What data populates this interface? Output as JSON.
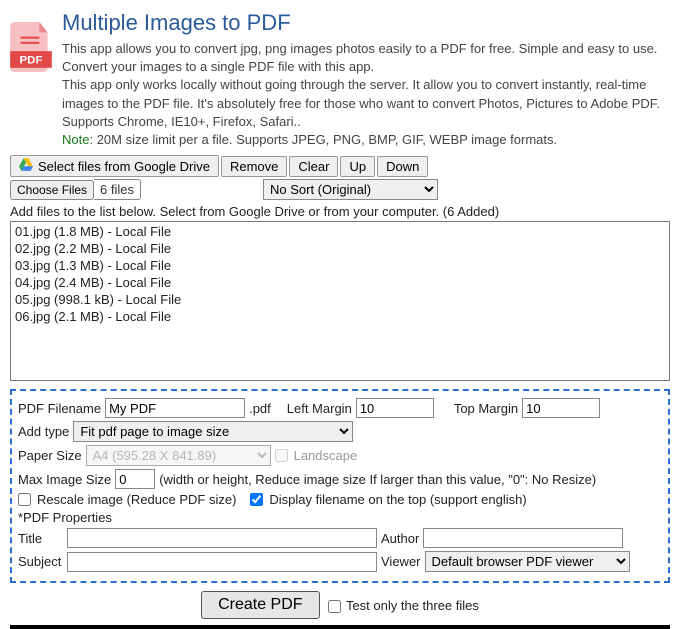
{
  "header": {
    "title": "Multiple Images to PDF",
    "desc1": "This app allows you to convert jpg, png images photos easily to a PDF for free. Simple and easy to use. Convert your images to a single PDF file with this app.",
    "desc2": "This app only works locally without going through the server. It allow you to convert instantly, real-time images to the PDF file. It's absolutely free for those who want to convert Photos, Pictures to Adobe PDF. Supports Chrome, IE10+, Firefox, Safari..",
    "note_label": "Note:",
    "note_text": " 20M size limit per a file. Supports JPEG, PNG, BMP, GIF, WEBP image formats."
  },
  "toolbar": {
    "gdrive": "Select files from Google Drive",
    "remove": "Remove",
    "clear": "Clear",
    "up": "Up",
    "down": "Down",
    "choose": "Choose Files",
    "file_count": "6 files",
    "sort_selected": "No Sort (Original)"
  },
  "instruction": "Add files to the list below. Select from Google Drive or from your computer. (6 Added)",
  "files": [
    "01.jpg (1.8 MB) - Local File",
    "02.jpg (2.2 MB) - Local File",
    "03.jpg (1.3 MB) - Local File",
    "04.jpg (2.4 MB) - Local File",
    "05.jpg (998.1 kB) - Local File",
    "06.jpg (2.1 MB) - Local File"
  ],
  "options": {
    "filename_label": "PDF Filename",
    "filename_value": "My PDF",
    "filename_ext": ".pdf",
    "left_margin_label": "Left Margin",
    "left_margin_value": "10",
    "top_margin_label": "Top Margin",
    "top_margin_value": "10",
    "addtype_label": "Add type",
    "addtype_value": "Fit pdf page to image size",
    "papersize_label": "Paper Size",
    "papersize_value": "A4 (595.28 X 841.89)",
    "landscape_label": "Landscape",
    "maximg_label": "Max Image Size",
    "maximg_value": "0",
    "maximg_hint": "(width or height, Reduce image size If larger than this value, \"0\": No Resize)",
    "rescale_label": "Rescale image (Reduce PDF size)",
    "displayfn_label": "Display filename on the top (support english)",
    "props_label": "*PDF Properties",
    "title_label": "Title",
    "author_label": "Author",
    "subject_label": "Subject",
    "viewer_label": "Viewer",
    "viewer_value": "Default browser PDF viewer"
  },
  "footer": {
    "create": "Create PDF",
    "test_label": "Test only the three files"
  }
}
